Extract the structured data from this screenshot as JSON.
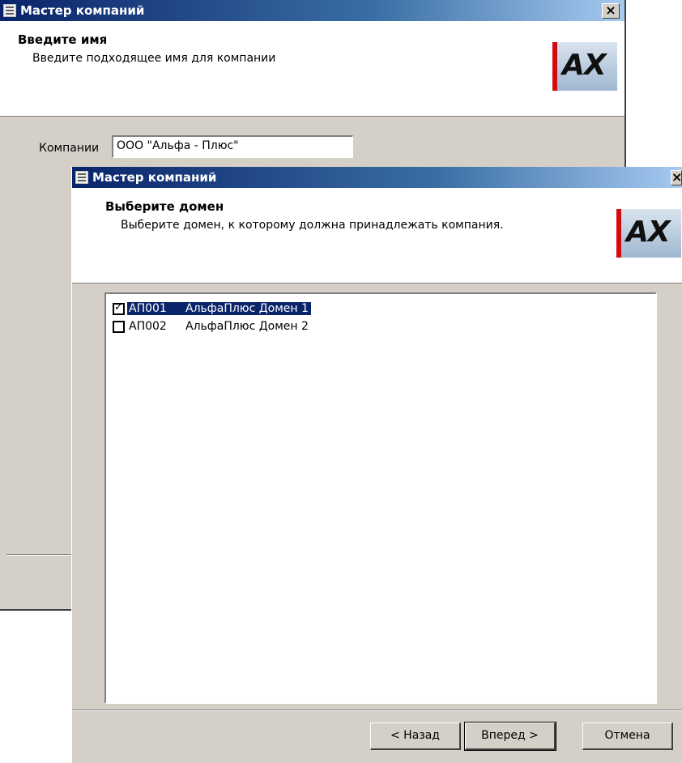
{
  "window1": {
    "title": "Мастер компаний",
    "close_glyph": "×",
    "header": {
      "title": "Введите имя",
      "subtitle": "Введите подходящее имя для компании",
      "logo_text": "AX"
    },
    "company_label": "Компании",
    "company_value": "ООО \"Альфа - Плюс\""
  },
  "window2": {
    "title": "Мастер компаний",
    "close_glyph": "×",
    "header": {
      "title": "Выберите домен",
      "subtitle": "Выберите домен, к которому должна принадлежать компания.",
      "logo_text": "AX"
    },
    "domains": [
      {
        "code": "АП001",
        "name": "АльфаПлюс Домен 1",
        "checked": true,
        "selected": true
      },
      {
        "code": "АП002",
        "name": "АльфаПлюс Домен 2",
        "checked": false,
        "selected": false
      }
    ],
    "buttons": {
      "back": "< Назад",
      "next": "Вперед >",
      "cancel": "Отмена"
    }
  },
  "icons": {
    "title_icon": "window-app-icon",
    "close": "close-icon",
    "checkbox": "checkbox-icon"
  },
  "colors": {
    "titlebar_start": "#0a246a",
    "titlebar_end": "#a6caf0",
    "selection": "#0a246a",
    "logo_red": "#d20c0c",
    "dialog_face": "#d4d0c8"
  }
}
